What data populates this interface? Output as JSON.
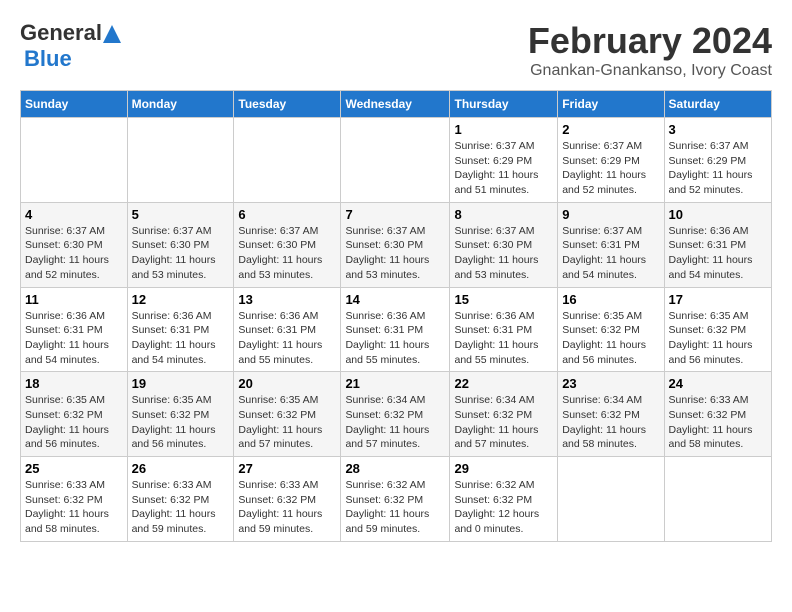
{
  "header": {
    "logo_line1": "General",
    "logo_line2": "Blue",
    "month_year": "February 2024",
    "location": "Gnankan-Gnankanso, Ivory Coast"
  },
  "weekdays": [
    "Sunday",
    "Monday",
    "Tuesday",
    "Wednesday",
    "Thursday",
    "Friday",
    "Saturday"
  ],
  "weeks": [
    [
      {
        "day": "",
        "info": ""
      },
      {
        "day": "",
        "info": ""
      },
      {
        "day": "",
        "info": ""
      },
      {
        "day": "",
        "info": ""
      },
      {
        "day": "1",
        "info": "Sunrise: 6:37 AM\nSunset: 6:29 PM\nDaylight: 11 hours\nand 51 minutes."
      },
      {
        "day": "2",
        "info": "Sunrise: 6:37 AM\nSunset: 6:29 PM\nDaylight: 11 hours\nand 52 minutes."
      },
      {
        "day": "3",
        "info": "Sunrise: 6:37 AM\nSunset: 6:29 PM\nDaylight: 11 hours\nand 52 minutes."
      }
    ],
    [
      {
        "day": "4",
        "info": "Sunrise: 6:37 AM\nSunset: 6:30 PM\nDaylight: 11 hours\nand 52 minutes."
      },
      {
        "day": "5",
        "info": "Sunrise: 6:37 AM\nSunset: 6:30 PM\nDaylight: 11 hours\nand 53 minutes."
      },
      {
        "day": "6",
        "info": "Sunrise: 6:37 AM\nSunset: 6:30 PM\nDaylight: 11 hours\nand 53 minutes."
      },
      {
        "day": "7",
        "info": "Sunrise: 6:37 AM\nSunset: 6:30 PM\nDaylight: 11 hours\nand 53 minutes."
      },
      {
        "day": "8",
        "info": "Sunrise: 6:37 AM\nSunset: 6:30 PM\nDaylight: 11 hours\nand 53 minutes."
      },
      {
        "day": "9",
        "info": "Sunrise: 6:37 AM\nSunset: 6:31 PM\nDaylight: 11 hours\nand 54 minutes."
      },
      {
        "day": "10",
        "info": "Sunrise: 6:36 AM\nSunset: 6:31 PM\nDaylight: 11 hours\nand 54 minutes."
      }
    ],
    [
      {
        "day": "11",
        "info": "Sunrise: 6:36 AM\nSunset: 6:31 PM\nDaylight: 11 hours\nand 54 minutes."
      },
      {
        "day": "12",
        "info": "Sunrise: 6:36 AM\nSunset: 6:31 PM\nDaylight: 11 hours\nand 54 minutes."
      },
      {
        "day": "13",
        "info": "Sunrise: 6:36 AM\nSunset: 6:31 PM\nDaylight: 11 hours\nand 55 minutes."
      },
      {
        "day": "14",
        "info": "Sunrise: 6:36 AM\nSunset: 6:31 PM\nDaylight: 11 hours\nand 55 minutes."
      },
      {
        "day": "15",
        "info": "Sunrise: 6:36 AM\nSunset: 6:31 PM\nDaylight: 11 hours\nand 55 minutes."
      },
      {
        "day": "16",
        "info": "Sunrise: 6:35 AM\nSunset: 6:32 PM\nDaylight: 11 hours\nand 56 minutes."
      },
      {
        "day": "17",
        "info": "Sunrise: 6:35 AM\nSunset: 6:32 PM\nDaylight: 11 hours\nand 56 minutes."
      }
    ],
    [
      {
        "day": "18",
        "info": "Sunrise: 6:35 AM\nSunset: 6:32 PM\nDaylight: 11 hours\nand 56 minutes."
      },
      {
        "day": "19",
        "info": "Sunrise: 6:35 AM\nSunset: 6:32 PM\nDaylight: 11 hours\nand 56 minutes."
      },
      {
        "day": "20",
        "info": "Sunrise: 6:35 AM\nSunset: 6:32 PM\nDaylight: 11 hours\nand 57 minutes."
      },
      {
        "day": "21",
        "info": "Sunrise: 6:34 AM\nSunset: 6:32 PM\nDaylight: 11 hours\nand 57 minutes."
      },
      {
        "day": "22",
        "info": "Sunrise: 6:34 AM\nSunset: 6:32 PM\nDaylight: 11 hours\nand 57 minutes."
      },
      {
        "day": "23",
        "info": "Sunrise: 6:34 AM\nSunset: 6:32 PM\nDaylight: 11 hours\nand 58 minutes."
      },
      {
        "day": "24",
        "info": "Sunrise: 6:33 AM\nSunset: 6:32 PM\nDaylight: 11 hours\nand 58 minutes."
      }
    ],
    [
      {
        "day": "25",
        "info": "Sunrise: 6:33 AM\nSunset: 6:32 PM\nDaylight: 11 hours\nand 58 minutes."
      },
      {
        "day": "26",
        "info": "Sunrise: 6:33 AM\nSunset: 6:32 PM\nDaylight: 11 hours\nand 59 minutes."
      },
      {
        "day": "27",
        "info": "Sunrise: 6:33 AM\nSunset: 6:32 PM\nDaylight: 11 hours\nand 59 minutes."
      },
      {
        "day": "28",
        "info": "Sunrise: 6:32 AM\nSunset: 6:32 PM\nDaylight: 11 hours\nand 59 minutes."
      },
      {
        "day": "29",
        "info": "Sunrise: 6:32 AM\nSunset: 6:32 PM\nDaylight: 12 hours\nand 0 minutes."
      },
      {
        "day": "",
        "info": ""
      },
      {
        "day": "",
        "info": ""
      }
    ]
  ]
}
